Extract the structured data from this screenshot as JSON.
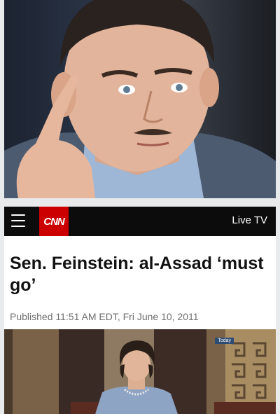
{
  "nav": {
    "logo": "CNN",
    "live_tv": "Live TV"
  },
  "article": {
    "headline": "Sen. Feinstein: al-Assad ‘must go’",
    "published": "Published 11:51 AM EDT, Fri June 10, 2011"
  },
  "video": {
    "bug": "Today"
  }
}
